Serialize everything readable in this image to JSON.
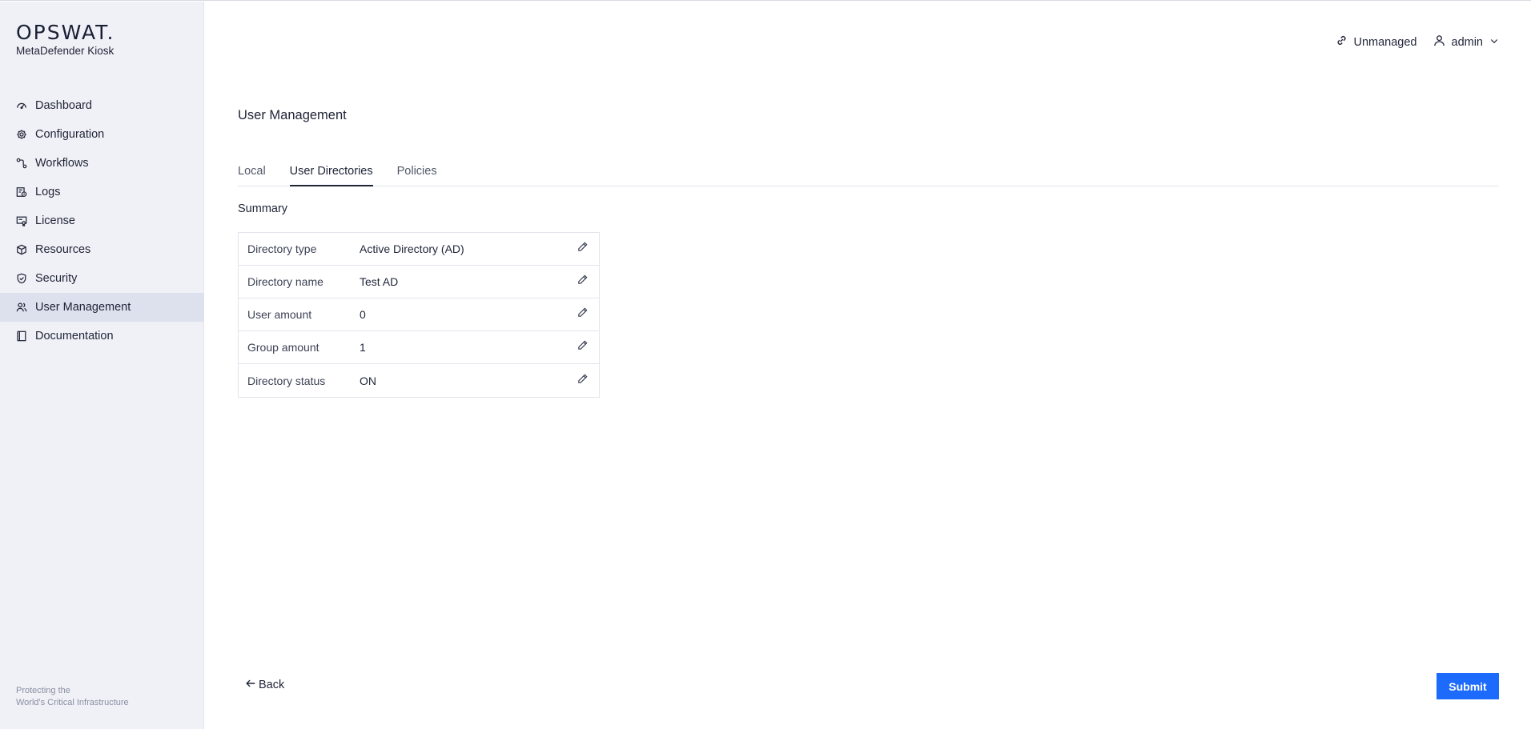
{
  "brand": {
    "logo": "OPSWAT.",
    "product": "MetaDefender Kiosk"
  },
  "sidebar": {
    "items": [
      {
        "label": "Dashboard",
        "icon": "dashboard-icon"
      },
      {
        "label": "Configuration",
        "icon": "gear-icon"
      },
      {
        "label": "Workflows",
        "icon": "workflow-icon"
      },
      {
        "label": "Logs",
        "icon": "logs-icon"
      },
      {
        "label": "License",
        "icon": "license-icon"
      },
      {
        "label": "Resources",
        "icon": "cube-icon"
      },
      {
        "label": "Security",
        "icon": "shield-icon"
      },
      {
        "label": "User Management",
        "icon": "users-icon",
        "active": true
      },
      {
        "label": "Documentation",
        "icon": "book-icon"
      }
    ],
    "footer_line1": "Protecting the",
    "footer_line2": "World's Critical Infrastructure"
  },
  "header": {
    "mode_label": "Unmanaged",
    "user_label": "admin"
  },
  "page": {
    "title": "User Management",
    "tabs": [
      {
        "label": "Local"
      },
      {
        "label": "User Directories",
        "active": true
      },
      {
        "label": "Policies"
      }
    ],
    "section_title": "Summary",
    "summary": [
      {
        "label": "Directory type",
        "value": "Active Directory (AD)"
      },
      {
        "label": "Directory name",
        "value": "Test AD"
      },
      {
        "label": "User amount",
        "value": "0"
      },
      {
        "label": "Group amount",
        "value": "1"
      },
      {
        "label": "Directory status",
        "value": "ON"
      }
    ],
    "back_label": "Back",
    "submit_label": "Submit"
  },
  "colors": {
    "accent": "#1d6bfc",
    "sidebar_bg": "#f0f1f6",
    "active_item_bg": "#dde1ee"
  }
}
